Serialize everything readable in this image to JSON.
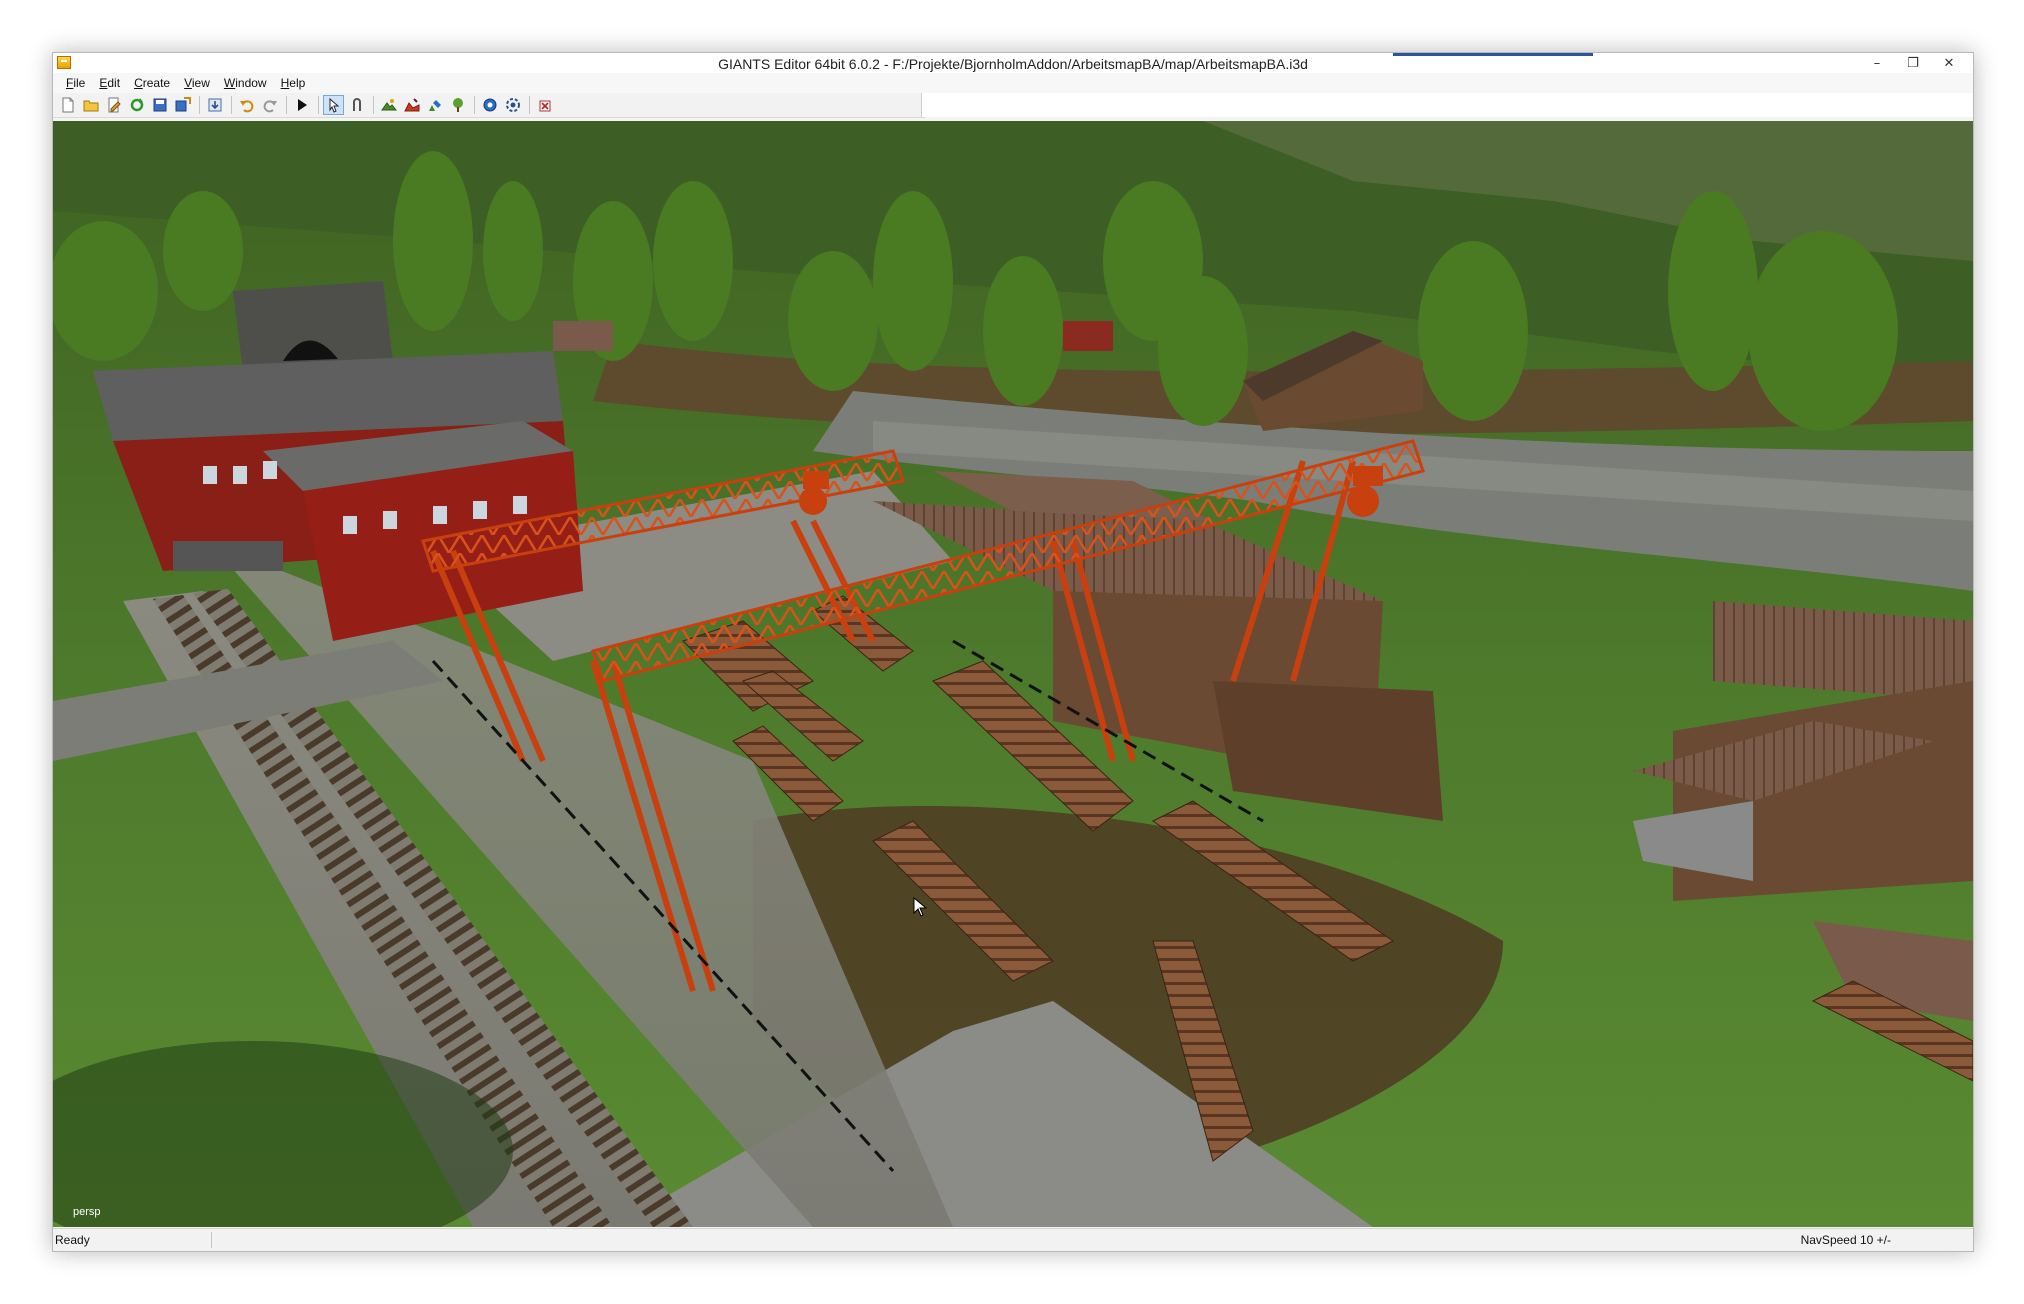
{
  "window": {
    "title": "GIANTS Editor 64bit 6.0.2 - F:/Projekte/BjornholmAddon/ArbeitsmapBA/map/ArbeitsmapBA.i3d",
    "controls": {
      "minimize": "–",
      "restore": "❐",
      "close": "✕"
    }
  },
  "menu": {
    "file": {
      "key": "F",
      "rest": "ile"
    },
    "edit": {
      "key": "E",
      "rest": "dit"
    },
    "create": {
      "key": "C",
      "rest": "reate"
    },
    "view": {
      "key": "V",
      "rest": "iew"
    },
    "window": {
      "key": "W",
      "rest": "indow"
    },
    "help": {
      "key": "H",
      "rest": "elp"
    }
  },
  "toolbar": {
    "icons": [
      "new-file-icon",
      "open-file-icon",
      "edit-file-icon",
      "reload-icon",
      "save-icon",
      "save-as-icon",
      "import-icon",
      "undo-icon",
      "redo-icon",
      "play-icon",
      "select-tool-icon",
      "move-tool-icon",
      "terrain-paint-icon",
      "terrain-sculpt-icon",
      "foliage-paint-icon",
      "tree-paint-icon",
      "cpu-icon",
      "settings-icon",
      "delete-icon"
    ]
  },
  "viewport": {
    "camera_label": "persp"
  },
  "status": {
    "ready": "Ready",
    "nav_speed": "NavSpeed 10 +/-"
  },
  "colors": {
    "grass": "#4e7a2c",
    "crane": "#c8400e",
    "barn": "#8a1f17",
    "title_accent": "#2b5797"
  }
}
